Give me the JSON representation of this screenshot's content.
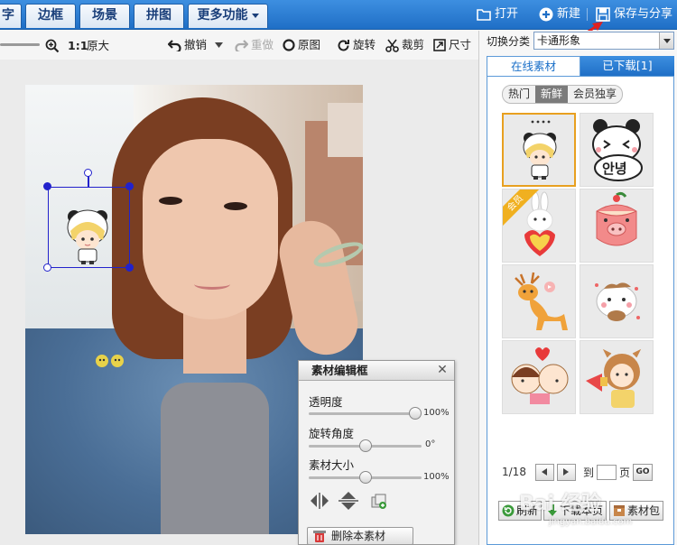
{
  "top_tabs": [
    {
      "label": "字"
    },
    {
      "label": "边框"
    },
    {
      "label": "场景"
    },
    {
      "label": "拼图"
    },
    {
      "label": "更多功能"
    }
  ],
  "top_actions": {
    "open": "打开",
    "new": "新建",
    "save_share": "保存与分享"
  },
  "toolbar": {
    "ratio": "1:1",
    "original_size": "原大",
    "undo": "撤销",
    "redo": "重做",
    "original_image": "原图",
    "rotate": "旋转",
    "crop": "裁剪",
    "size": "尺寸"
  },
  "edit_panel": {
    "title": "素材编辑框",
    "opacity_label": "透明度",
    "opacity_value": "100%",
    "opacity_level": 1.0,
    "angle_label": "旋转角度",
    "angle_value": "0°",
    "angle_level": 0.5,
    "scale_label": "素材大小",
    "scale_value": "100%",
    "scale_level": 0.5,
    "delete_label": "删除本素材"
  },
  "right_panel": {
    "switch_label": "切换分类",
    "category": "卡通形象",
    "tab_online": "在线素材",
    "tab_downloaded": "已下载[1]",
    "pills": [
      "热门",
      "新鲜",
      "会员独享"
    ],
    "active_pill": "新鲜",
    "vip_badge": "会员",
    "sticker_text": "안녕",
    "page_info": "1/18",
    "goto_label": "到",
    "page_label": "页",
    "go_label": "GO",
    "refresh": "刷新",
    "download_page": "下载本页",
    "package": "素材包"
  },
  "watermark": {
    "brand": "Bai 经验",
    "url": "jingyan.baidu.com"
  },
  "colors": {
    "topbar": "#2a7dd4",
    "selection": "#2222cc",
    "accent": "#1a6fc8",
    "selected_cell": "#e8a020"
  }
}
